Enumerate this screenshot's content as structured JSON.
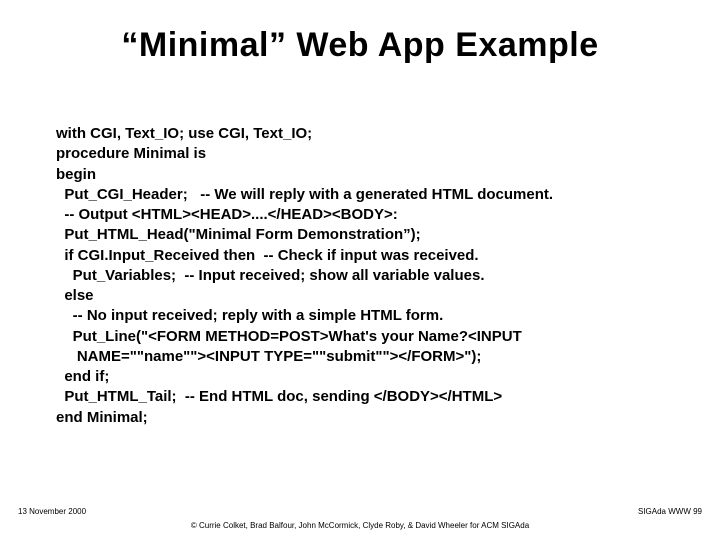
{
  "title": "“Minimal” Web App Example",
  "code": "with CGI, Text_IO; use CGI, Text_IO;\nprocedure Minimal is\nbegin\n  Put_CGI_Header;   -- We will reply with a generated HTML document.\n  -- Output <HTML><HEAD>....</HEAD><BODY>:\n  Put_HTML_Head(\"Minimal Form Demonstration”);\n  if CGI.Input_Received then  -- Check if input was received.\n    Put_Variables;  -- Input received; show all variable values.\n  else\n    -- No input received; reply with a simple HTML form.\n    Put_Line(\"<FORM METHOD=POST>What's your Name?<INPUT\n     NAME=\"\"name\"\"><INPUT TYPE=\"\"submit\"\"></FORM>\");\n  end if;\n  Put_HTML_Tail;  -- End HTML doc, sending </BODY></HTML>\nend Minimal;",
  "footer": {
    "left": "13 November 2000",
    "right": "SIGAda WWW 99",
    "center": "© Currie Colket, Brad Balfour, John McCormick, Clyde Roby, & David Wheeler for ACM SIGAda"
  }
}
